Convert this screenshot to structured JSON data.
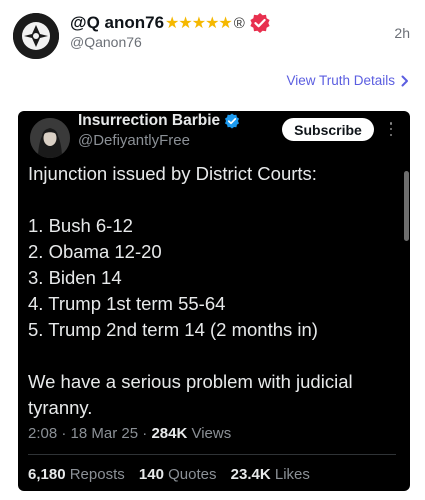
{
  "post": {
    "display_name": "@Q anon76",
    "stars": "★★★★★",
    "reg_mark": "®",
    "handle": "@Qanon76",
    "time_ago": "2h",
    "details_link": "View Truth Details"
  },
  "embed": {
    "display_name": "Insurrection Barbie",
    "handle": "@DefiyantlyFree",
    "subscribe_label": "Subscribe",
    "lines": [
      "Injunction issued by District Courts:",
      "1. Bush 6-12",
      "2. Obama 12-20",
      "3. Biden 14",
      "4. Trump 1st term 55-64",
      "5. Trump 2nd term 14 (2 months in)",
      "We have a serious problem with judicial tyranny."
    ],
    "time": "2:08",
    "date": "18 Mar 25",
    "views_count": "284K",
    "views_label": "Views",
    "reposts_count": "6,180",
    "reposts_label": "Reposts",
    "quotes_count": "140",
    "quotes_label": "Quotes",
    "likes_count": "23.4K",
    "likes_label": "Likes"
  },
  "icons": {
    "verified_badge": "verified-badge-icon",
    "chevron": "chevron-right-icon",
    "more": "more-options-icon"
  },
  "colors": {
    "link": "#5b5ee0",
    "verified_red": "#e8304f",
    "verified_blue": "#1d9bf0",
    "stars": "#f5b800",
    "embed_bg": "#000000"
  }
}
